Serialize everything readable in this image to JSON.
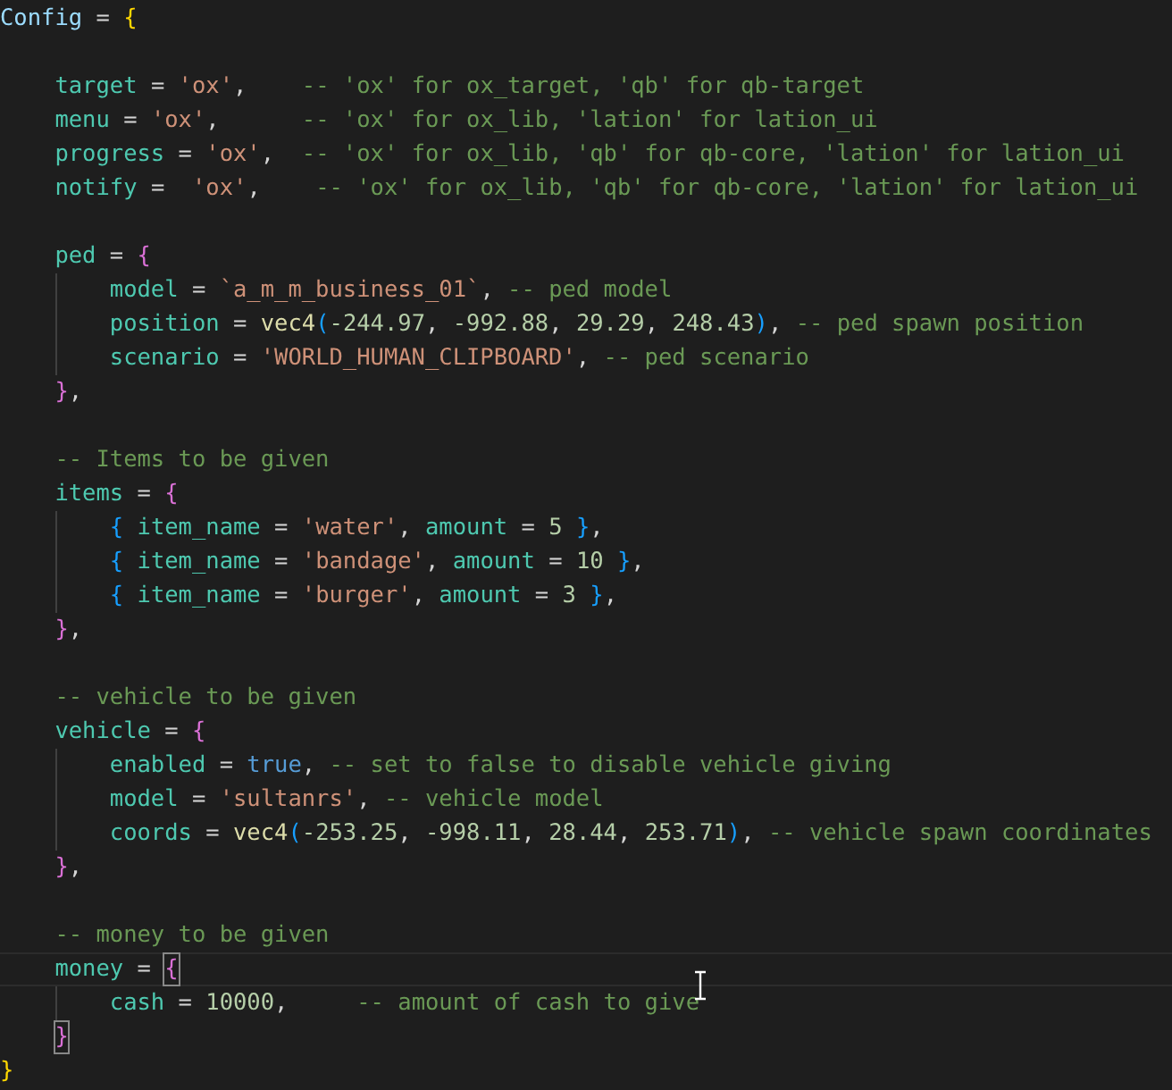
{
  "editor": {
    "lines": [
      {
        "kind": "code",
        "tokens": [
          {
            "kind": "global",
            "text": "Config"
          },
          {
            "kind": "op",
            "text": " = "
          },
          {
            "kind": "bracket",
            "text": "{",
            "color": "#ffd700"
          }
        ],
        "children": [
          {
            "kind": "blank"
          },
          {
            "kind": "code",
            "tokens": [
              {
                "kind": "field",
                "text": "target"
              },
              {
                "kind": "op",
                "text": " = "
              },
              {
                "kind": "str",
                "text": "'ox'"
              },
              {
                "kind": "punct",
                "text": ",    "
              },
              {
                "kind": "comment",
                "text": "-- 'ox' for ox_target, 'qb' for qb-target"
              }
            ]
          },
          {
            "kind": "code",
            "tokens": [
              {
                "kind": "field",
                "text": "menu"
              },
              {
                "kind": "op",
                "text": " = "
              },
              {
                "kind": "str",
                "text": "'ox'"
              },
              {
                "kind": "punct",
                "text": ",      "
              },
              {
                "kind": "comment",
                "text": "-- 'ox' for ox_lib, 'lation' for lation_ui"
              }
            ]
          },
          {
            "kind": "code",
            "tokens": [
              {
                "kind": "field",
                "text": "progress"
              },
              {
                "kind": "op",
                "text": " = "
              },
              {
                "kind": "str",
                "text": "'ox'"
              },
              {
                "kind": "punct",
                "text": ",  "
              },
              {
                "kind": "comment",
                "text": "-- 'ox' for ox_lib, 'qb' for qb-core, 'lation' for lation_ui"
              }
            ]
          },
          {
            "kind": "code",
            "tokens": [
              {
                "kind": "field",
                "text": "notify"
              },
              {
                "kind": "op",
                "text": " =  "
              },
              {
                "kind": "str",
                "text": "'ox'"
              },
              {
                "kind": "punct",
                "text": ",    "
              },
              {
                "kind": "comment",
                "text": "-- 'ox' for ox_lib, 'qb' for qb-core, 'lation' for lation_ui"
              }
            ]
          },
          {
            "kind": "blank"
          },
          {
            "kind": "code",
            "tokens": [
              {
                "kind": "field",
                "text": "ped"
              },
              {
                "kind": "op",
                "text": " = "
              },
              {
                "kind": "bracket",
                "text": "{",
                "color": "#da70d6"
              }
            ],
            "children": [
              {
                "kind": "code",
                "tokens": [
                  {
                    "kind": "field",
                    "text": "model"
                  },
                  {
                    "kind": "op",
                    "text": " = "
                  },
                  {
                    "kind": "str",
                    "text": "`a_m_m_business_01`"
                  },
                  {
                    "kind": "punct",
                    "text": ", "
                  },
                  {
                    "kind": "comment",
                    "text": "-- ped model"
                  }
                ]
              },
              {
                "kind": "code",
                "tokens": [
                  {
                    "kind": "field",
                    "text": "position"
                  },
                  {
                    "kind": "op",
                    "text": " = "
                  },
                  {
                    "kind": "func",
                    "text": "vec4"
                  },
                  {
                    "kind": "bracket",
                    "text": "(",
                    "color": "#179fff"
                  },
                  {
                    "kind": "num",
                    "text": "-244.97"
                  },
                  {
                    "kind": "punct",
                    "text": ", "
                  },
                  {
                    "kind": "num",
                    "text": "-992.88"
                  },
                  {
                    "kind": "punct",
                    "text": ", "
                  },
                  {
                    "kind": "num",
                    "text": "29.29"
                  },
                  {
                    "kind": "punct",
                    "text": ", "
                  },
                  {
                    "kind": "num",
                    "text": "248.43"
                  },
                  {
                    "kind": "bracket",
                    "text": ")",
                    "color": "#179fff"
                  },
                  {
                    "kind": "punct",
                    "text": ", "
                  },
                  {
                    "kind": "comment",
                    "text": "-- ped spawn position"
                  }
                ]
              },
              {
                "kind": "code",
                "tokens": [
                  {
                    "kind": "field",
                    "text": "scenario"
                  },
                  {
                    "kind": "op",
                    "text": " = "
                  },
                  {
                    "kind": "str",
                    "text": "'WORLD_HUMAN_CLIPBOARD'"
                  },
                  {
                    "kind": "punct",
                    "text": ", "
                  },
                  {
                    "kind": "comment",
                    "text": "-- ped scenario"
                  }
                ]
              }
            ]
          },
          {
            "kind": "code",
            "tokens": [
              {
                "kind": "bracket",
                "text": "}",
                "color": "#da70d6"
              },
              {
                "kind": "punct",
                "text": ","
              }
            ]
          },
          {
            "kind": "blank"
          },
          {
            "kind": "code",
            "tokens": [
              {
                "kind": "comment",
                "text": "-- Items to be given"
              }
            ]
          },
          {
            "kind": "code",
            "tokens": [
              {
                "kind": "field",
                "text": "items"
              },
              {
                "kind": "op",
                "text": " = "
              },
              {
                "kind": "bracket",
                "text": "{",
                "color": "#da70d6"
              }
            ],
            "children": [
              {
                "kind": "code",
                "tokens": [
                  {
                    "kind": "bracket",
                    "text": "{ ",
                    "color": "#179fff"
                  },
                  {
                    "kind": "field",
                    "text": "item_name"
                  },
                  {
                    "kind": "op",
                    "text": " = "
                  },
                  {
                    "kind": "str",
                    "text": "'water'"
                  },
                  {
                    "kind": "punct",
                    "text": ", "
                  },
                  {
                    "kind": "field",
                    "text": "amount"
                  },
                  {
                    "kind": "op",
                    "text": " = "
                  },
                  {
                    "kind": "num",
                    "text": "5 "
                  },
                  {
                    "kind": "bracket",
                    "text": "}",
                    "color": "#179fff"
                  },
                  {
                    "kind": "punct",
                    "text": ","
                  }
                ]
              },
              {
                "kind": "code",
                "tokens": [
                  {
                    "kind": "bracket",
                    "text": "{ ",
                    "color": "#179fff"
                  },
                  {
                    "kind": "field",
                    "text": "item_name"
                  },
                  {
                    "kind": "op",
                    "text": " = "
                  },
                  {
                    "kind": "str",
                    "text": "'bandage'"
                  },
                  {
                    "kind": "punct",
                    "text": ", "
                  },
                  {
                    "kind": "field",
                    "text": "amount"
                  },
                  {
                    "kind": "op",
                    "text": " = "
                  },
                  {
                    "kind": "num",
                    "text": "10 "
                  },
                  {
                    "kind": "bracket",
                    "text": "}",
                    "color": "#179fff"
                  },
                  {
                    "kind": "punct",
                    "text": ","
                  }
                ]
              },
              {
                "kind": "code",
                "tokens": [
                  {
                    "kind": "bracket",
                    "text": "{ ",
                    "color": "#179fff"
                  },
                  {
                    "kind": "field",
                    "text": "item_name"
                  },
                  {
                    "kind": "op",
                    "text": " = "
                  },
                  {
                    "kind": "str",
                    "text": "'burger'"
                  },
                  {
                    "kind": "punct",
                    "text": ", "
                  },
                  {
                    "kind": "field",
                    "text": "amount"
                  },
                  {
                    "kind": "op",
                    "text": " = "
                  },
                  {
                    "kind": "num",
                    "text": "3 "
                  },
                  {
                    "kind": "bracket",
                    "text": "}",
                    "color": "#179fff"
                  },
                  {
                    "kind": "punct",
                    "text": ","
                  }
                ]
              }
            ]
          },
          {
            "kind": "code",
            "tokens": [
              {
                "kind": "bracket",
                "text": "}",
                "color": "#da70d6"
              },
              {
                "kind": "punct",
                "text": ","
              }
            ]
          },
          {
            "kind": "blank"
          },
          {
            "kind": "code",
            "tokens": [
              {
                "kind": "comment",
                "text": "-- vehicle to be given"
              }
            ]
          },
          {
            "kind": "code",
            "tokens": [
              {
                "kind": "field",
                "text": "vehicle"
              },
              {
                "kind": "op",
                "text": " = "
              },
              {
                "kind": "bracket",
                "text": "{",
                "color": "#da70d6"
              }
            ],
            "children": [
              {
                "kind": "code",
                "tokens": [
                  {
                    "kind": "field",
                    "text": "enabled"
                  },
                  {
                    "kind": "op",
                    "text": " = "
                  },
                  {
                    "kind": "keyword",
                    "text": "true"
                  },
                  {
                    "kind": "punct",
                    "text": ", "
                  },
                  {
                    "kind": "comment",
                    "text": "-- set to false to disable vehicle giving"
                  }
                ]
              },
              {
                "kind": "code",
                "tokens": [
                  {
                    "kind": "field",
                    "text": "model"
                  },
                  {
                    "kind": "op",
                    "text": " = "
                  },
                  {
                    "kind": "str",
                    "text": "'sultanrs'"
                  },
                  {
                    "kind": "punct",
                    "text": ", "
                  },
                  {
                    "kind": "comment",
                    "text": "-- vehicle model"
                  }
                ]
              },
              {
                "kind": "code",
                "tokens": [
                  {
                    "kind": "field",
                    "text": "coords"
                  },
                  {
                    "kind": "op",
                    "text": " = "
                  },
                  {
                    "kind": "func",
                    "text": "vec4"
                  },
                  {
                    "kind": "bracket",
                    "text": "(",
                    "color": "#179fff"
                  },
                  {
                    "kind": "num",
                    "text": "-253.25"
                  },
                  {
                    "kind": "punct",
                    "text": ", "
                  },
                  {
                    "kind": "num",
                    "text": "-998.11"
                  },
                  {
                    "kind": "punct",
                    "text": ", "
                  },
                  {
                    "kind": "num",
                    "text": "28.44"
                  },
                  {
                    "kind": "punct",
                    "text": ", "
                  },
                  {
                    "kind": "num",
                    "text": "253.71"
                  },
                  {
                    "kind": "bracket",
                    "text": ")",
                    "color": "#179fff"
                  },
                  {
                    "kind": "punct",
                    "text": ", "
                  },
                  {
                    "kind": "comment",
                    "text": "-- vehicle spawn coordinates"
                  }
                ]
              }
            ]
          },
          {
            "kind": "code",
            "tokens": [
              {
                "kind": "bracket",
                "text": "}",
                "color": "#da70d6"
              },
              {
                "kind": "punct",
                "text": ","
              }
            ]
          },
          {
            "kind": "blank"
          },
          {
            "kind": "code",
            "tokens": [
              {
                "kind": "comment",
                "text": "-- money to be given"
              }
            ]
          },
          {
            "kind": "code",
            "current": true,
            "tokens": [
              {
                "kind": "field",
                "text": "money"
              },
              {
                "kind": "op",
                "text": " = "
              },
              {
                "kind": "bracket",
                "text": "{",
                "color": "#da70d6",
                "matched": true
              }
            ],
            "children": [
              {
                "kind": "code",
                "tokens": [
                  {
                    "kind": "field",
                    "text": "cash"
                  },
                  {
                    "kind": "op",
                    "text": " = "
                  },
                  {
                    "kind": "num",
                    "text": "10000"
                  },
                  {
                    "kind": "punct",
                    "text": ",     "
                  },
                  {
                    "kind": "comment",
                    "text": "-- amount of cash to give"
                  }
                ]
              }
            ]
          },
          {
            "kind": "code",
            "tokens": [
              {
                "kind": "bracket",
                "text": "}",
                "color": "#da70d6",
                "matched": true
              }
            ]
          }
        ]
      },
      {
        "kind": "code",
        "tokens": [
          {
            "kind": "bracket",
            "text": "}",
            "color": "#ffd700"
          }
        ]
      }
    ]
  }
}
